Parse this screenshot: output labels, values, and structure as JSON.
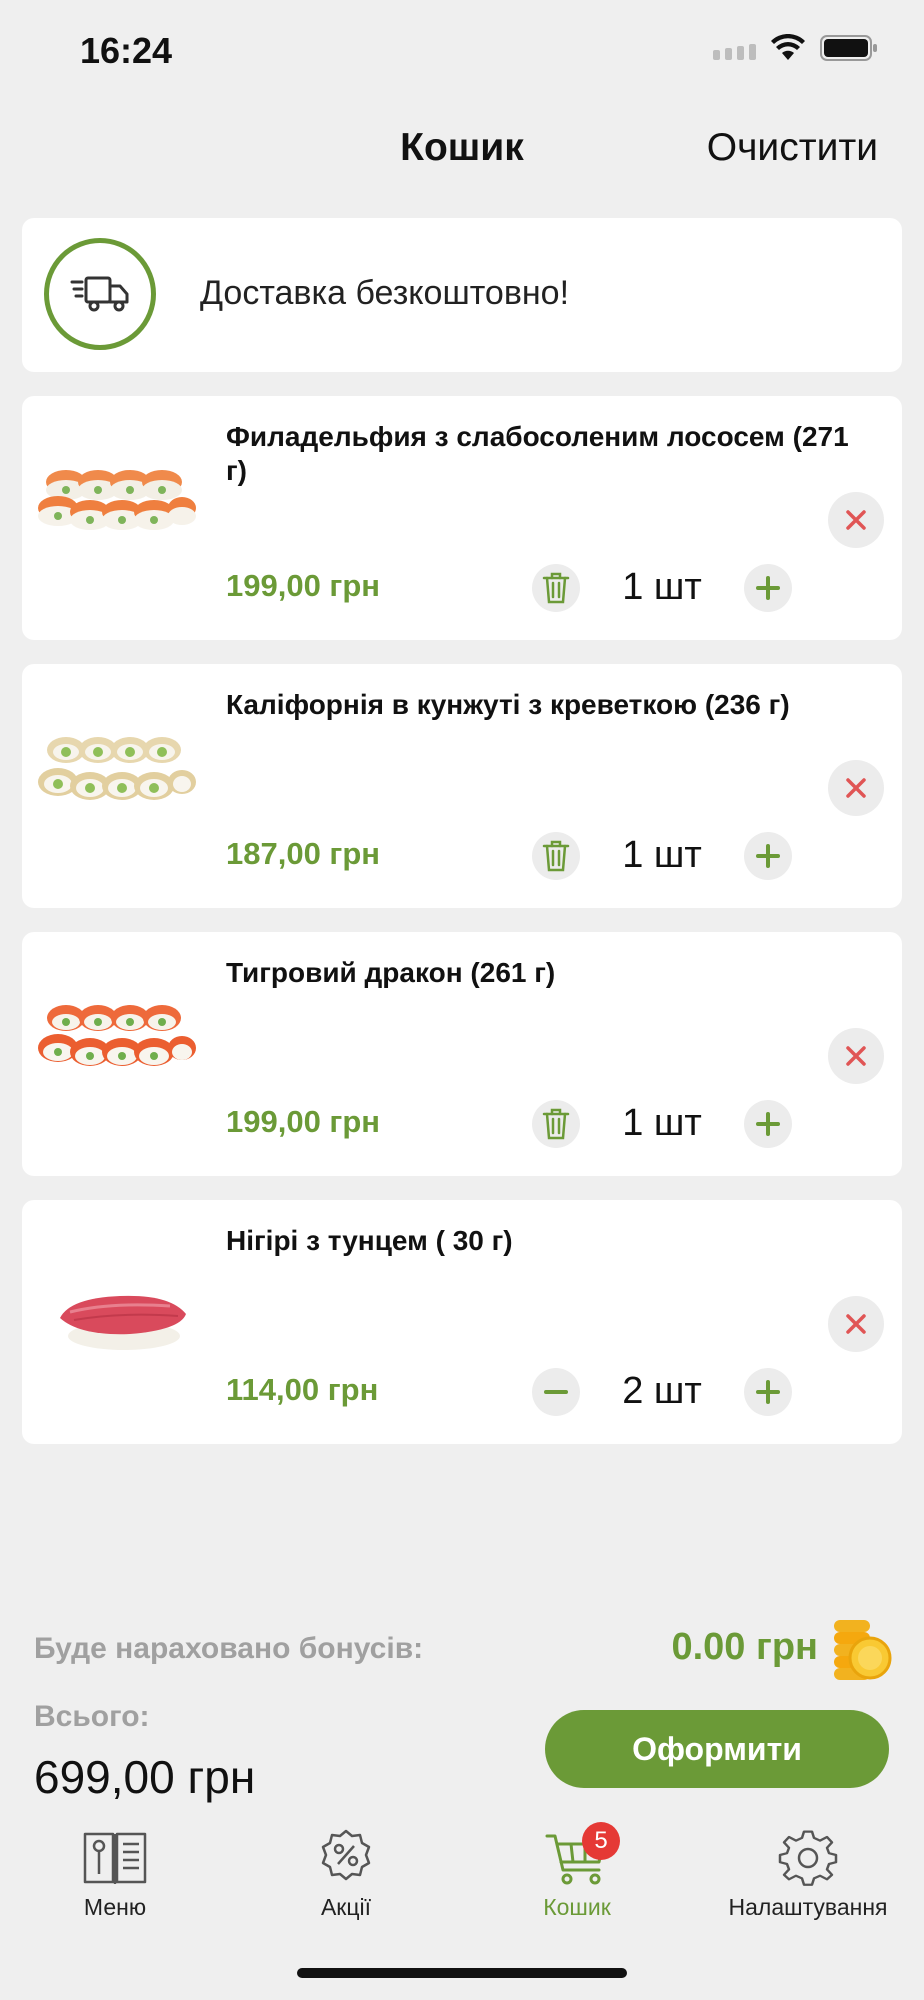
{
  "status": {
    "time": "16:24"
  },
  "header": {
    "title": "Кошик",
    "clear_label": "Очистити"
  },
  "delivery": {
    "text": "Доставка безкоштовно!",
    "icon": "delivery-truck-icon"
  },
  "items": [
    {
      "name": "Филадельфия з слабосоленим лососем (271 г)",
      "price": "199,00 грн",
      "qty": "1 шт",
      "left_control": "trash-icon"
    },
    {
      "name": "Каліфорнія в кунжуті з креветкою (236 г)",
      "price": "187,00 грн",
      "qty": "1 шт",
      "left_control": "trash-icon"
    },
    {
      "name": "Тигровий дракон (261 г)",
      "price": "199,00 грн",
      "qty": "1 шт",
      "left_control": "trash-icon"
    },
    {
      "name": "Нігірі з тунцем ( 30 г)",
      "price": "114,00 грн",
      "qty": "2 шт",
      "left_control": "minus-icon"
    }
  ],
  "summary": {
    "bonus_label": "Буде нараховано бонусів:",
    "bonus_value": "0.00 грн",
    "total_label": "Всього:",
    "total_value": "699,00 грн",
    "checkout_label": "Оформити"
  },
  "tabs": [
    {
      "label": "Меню",
      "icon": "menu-book-icon",
      "active": false
    },
    {
      "label": "Акції",
      "icon": "discount-icon",
      "active": false
    },
    {
      "label": "Кошик",
      "icon": "cart-icon",
      "active": true,
      "badge": "5"
    },
    {
      "label": "Налаштування",
      "icon": "gear-icon",
      "active": false
    }
  ],
  "colors": {
    "accent": "#6b9a37",
    "badge": "#e53935",
    "remove": "#e05555",
    "background": "#efefef"
  }
}
